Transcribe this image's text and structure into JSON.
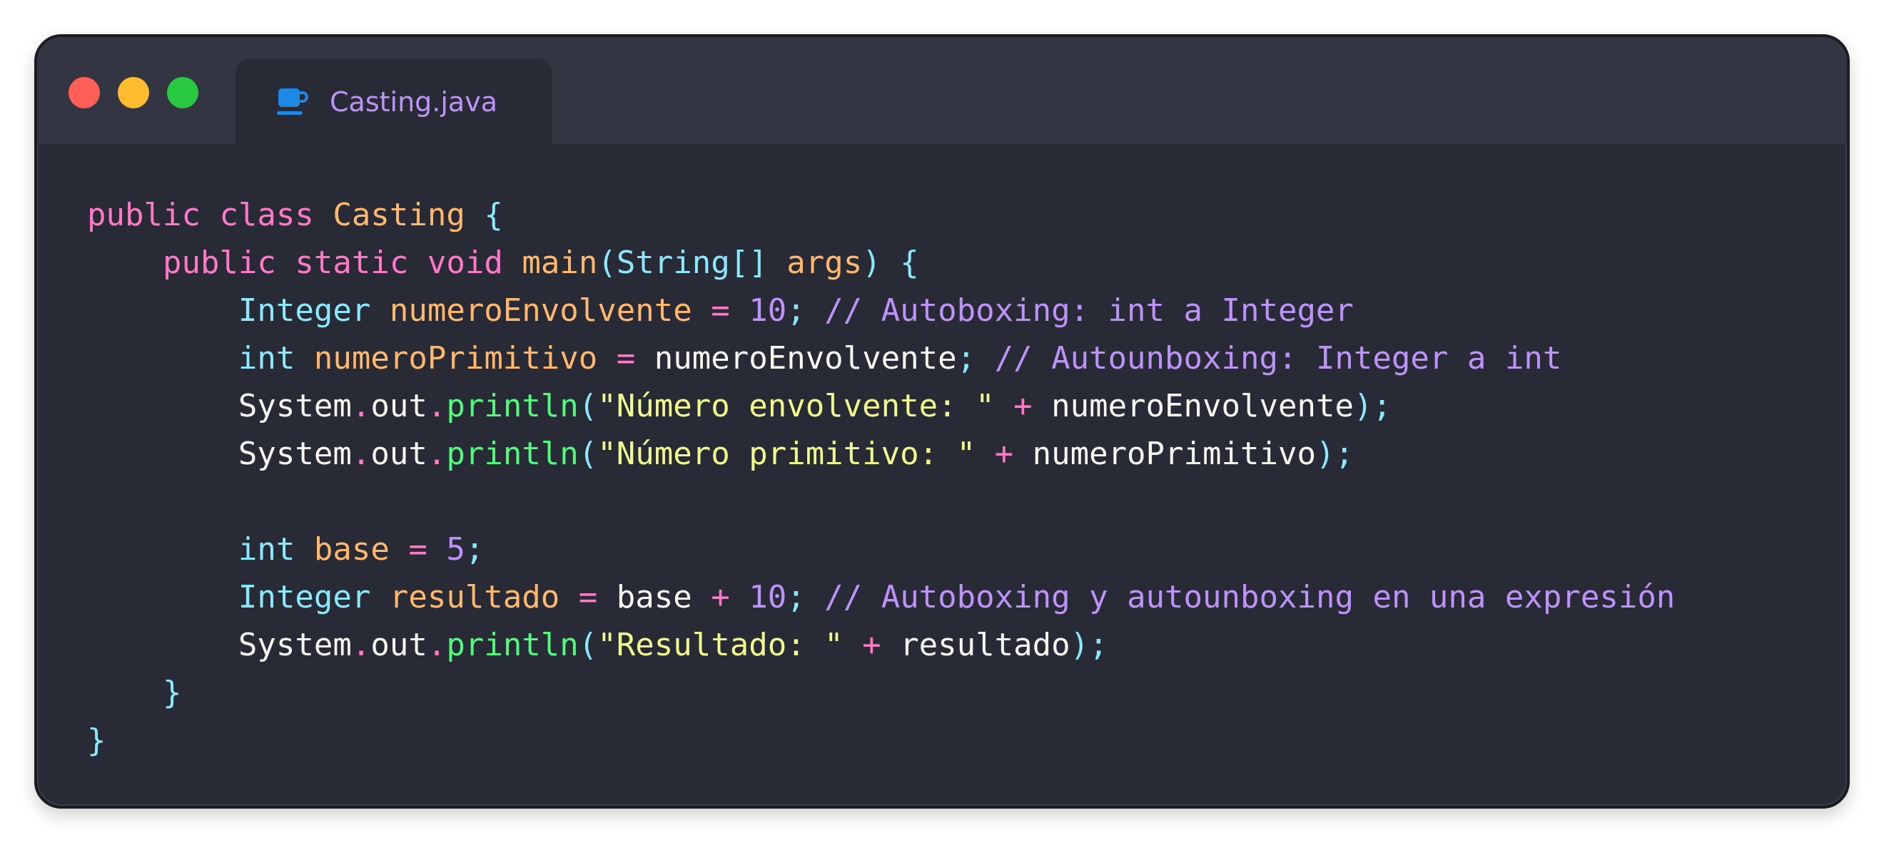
{
  "window": {
    "traffic_lights": [
      {
        "name": "close",
        "color": "#ff5f57"
      },
      {
        "name": "minimize",
        "color": "#febc2e"
      },
      {
        "name": "maximize",
        "color": "#28c840"
      }
    ],
    "tab": {
      "icon": "java-coffee-cup-icon",
      "icon_color": "#1e88e5",
      "label": "Casting.java"
    }
  },
  "colors": {
    "background": "#282a36",
    "titlebar": "#343543",
    "keyword": "#ff79c6",
    "type": "#8be9fd",
    "variable": "#ffb86c",
    "number_comment": "#bd93f9",
    "method_call": "#50fa7b",
    "string": "#f1fa8c",
    "plain": "#f8f8f2"
  },
  "code": {
    "lines": [
      [
        {
          "t": "public",
          "k": "keyword"
        },
        {
          "t": " "
        },
        {
          "t": "class",
          "k": "keyword"
        },
        {
          "t": " "
        },
        {
          "t": "Casting",
          "k": "class"
        },
        {
          "t": " "
        },
        {
          "t": "{",
          "k": "punct"
        }
      ],
      [
        {
          "t": "    "
        },
        {
          "t": "public",
          "k": "keyword"
        },
        {
          "t": " "
        },
        {
          "t": "static",
          "k": "keyword"
        },
        {
          "t": " "
        },
        {
          "t": "void",
          "k": "keyword"
        },
        {
          "t": " "
        },
        {
          "t": "main",
          "k": "method"
        },
        {
          "t": "(",
          "k": "punct"
        },
        {
          "t": "String[]",
          "k": "type"
        },
        {
          "t": " "
        },
        {
          "t": "args",
          "k": "param"
        },
        {
          "t": ")",
          "k": "punct"
        },
        {
          "t": " "
        },
        {
          "t": "{",
          "k": "punct"
        }
      ],
      [
        {
          "t": "        "
        },
        {
          "t": "Integer",
          "k": "type"
        },
        {
          "t": " "
        },
        {
          "t": "numeroEnvolvente",
          "k": "var"
        },
        {
          "t": " "
        },
        {
          "t": "=",
          "k": "op"
        },
        {
          "t": " "
        },
        {
          "t": "10",
          "k": "number"
        },
        {
          "t": ";",
          "k": "punct"
        },
        {
          "t": " "
        },
        {
          "t": "// Autoboxing: int a Integer",
          "k": "comment"
        }
      ],
      [
        {
          "t": "        "
        },
        {
          "t": "int",
          "k": "type"
        },
        {
          "t": " "
        },
        {
          "t": "numeroPrimitivo",
          "k": "var"
        },
        {
          "t": " "
        },
        {
          "t": "=",
          "k": "op"
        },
        {
          "t": " "
        },
        {
          "t": "numeroEnvolvente",
          "k": "plain"
        },
        {
          "t": ";",
          "k": "punct"
        },
        {
          "t": " "
        },
        {
          "t": "// Autounboxing: Integer a int",
          "k": "comment"
        }
      ],
      [
        {
          "t": "        "
        },
        {
          "t": "System",
          "k": "plain"
        },
        {
          "t": ".",
          "k": "dot"
        },
        {
          "t": "out",
          "k": "plain"
        },
        {
          "t": ".",
          "k": "dot"
        },
        {
          "t": "println",
          "k": "call"
        },
        {
          "t": "(",
          "k": "punct"
        },
        {
          "t": "\"Número envolvente: \"",
          "k": "string"
        },
        {
          "t": " "
        },
        {
          "t": "+",
          "k": "op"
        },
        {
          "t": " "
        },
        {
          "t": "numeroEnvolvente",
          "k": "plain"
        },
        {
          "t": ");",
          "k": "punct"
        }
      ],
      [
        {
          "t": "        "
        },
        {
          "t": "System",
          "k": "plain"
        },
        {
          "t": ".",
          "k": "dot"
        },
        {
          "t": "out",
          "k": "plain"
        },
        {
          "t": ".",
          "k": "dot"
        },
        {
          "t": "println",
          "k": "call"
        },
        {
          "t": "(",
          "k": "punct"
        },
        {
          "t": "\"Número primitivo: \"",
          "k": "string"
        },
        {
          "t": " "
        },
        {
          "t": "+",
          "k": "op"
        },
        {
          "t": " "
        },
        {
          "t": "numeroPrimitivo",
          "k": "plain"
        },
        {
          "t": ");",
          "k": "punct"
        }
      ],
      [],
      [
        {
          "t": "        "
        },
        {
          "t": "int",
          "k": "type"
        },
        {
          "t": " "
        },
        {
          "t": "base",
          "k": "var"
        },
        {
          "t": " "
        },
        {
          "t": "=",
          "k": "op"
        },
        {
          "t": " "
        },
        {
          "t": "5",
          "k": "number"
        },
        {
          "t": ";",
          "k": "punct"
        }
      ],
      [
        {
          "t": "        "
        },
        {
          "t": "Integer",
          "k": "type"
        },
        {
          "t": " "
        },
        {
          "t": "resultado",
          "k": "var"
        },
        {
          "t": " "
        },
        {
          "t": "=",
          "k": "op"
        },
        {
          "t": " "
        },
        {
          "t": "base",
          "k": "plain"
        },
        {
          "t": " "
        },
        {
          "t": "+",
          "k": "op"
        },
        {
          "t": " "
        },
        {
          "t": "10",
          "k": "number"
        },
        {
          "t": ";",
          "k": "punct"
        },
        {
          "t": " "
        },
        {
          "t": "// Autoboxing y autounboxing en una expresión",
          "k": "comment"
        }
      ],
      [
        {
          "t": "        "
        },
        {
          "t": "System",
          "k": "plain"
        },
        {
          "t": ".",
          "k": "dot"
        },
        {
          "t": "out",
          "k": "plain"
        },
        {
          "t": ".",
          "k": "dot"
        },
        {
          "t": "println",
          "k": "call"
        },
        {
          "t": "(",
          "k": "punct"
        },
        {
          "t": "\"Resultado: \"",
          "k": "string"
        },
        {
          "t": " "
        },
        {
          "t": "+",
          "k": "op"
        },
        {
          "t": " "
        },
        {
          "t": "resultado",
          "k": "plain"
        },
        {
          "t": ");",
          "k": "punct"
        }
      ],
      [
        {
          "t": "    "
        },
        {
          "t": "}",
          "k": "punct"
        }
      ],
      [
        {
          "t": "}",
          "k": "punct"
        }
      ]
    ]
  }
}
